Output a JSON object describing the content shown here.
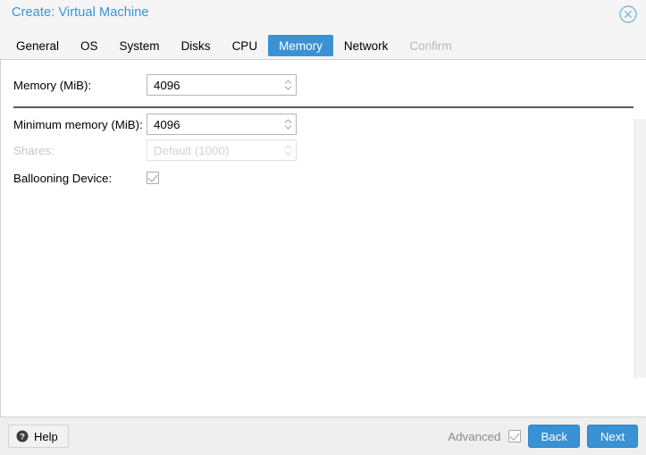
{
  "window": {
    "title": "Create: Virtual Machine",
    "close_icon": "close-circle-icon"
  },
  "tabs": [
    {
      "label": "General",
      "state": "normal"
    },
    {
      "label": "OS",
      "state": "normal"
    },
    {
      "label": "System",
      "state": "normal"
    },
    {
      "label": "Disks",
      "state": "normal"
    },
    {
      "label": "CPU",
      "state": "normal"
    },
    {
      "label": "Memory",
      "state": "active"
    },
    {
      "label": "Network",
      "state": "normal"
    },
    {
      "label": "Confirm",
      "state": "disabled"
    }
  ],
  "form": {
    "memory": {
      "label": "Memory (MiB):",
      "value": "4096",
      "spinner_icon": "spinner-updown-icon"
    },
    "minimum_memory": {
      "label": "Minimum memory (MiB):",
      "value": "4096",
      "spinner_icon": "spinner-updown-icon"
    },
    "shares": {
      "label": "Shares:",
      "placeholder": "Default (1000)",
      "spinner_icon": "spinner-updown-icon"
    },
    "ballooning": {
      "label": "Ballooning Device:",
      "checked": true
    }
  },
  "footer": {
    "help_label": "Help",
    "help_icon": "question-circle-icon",
    "advanced_label": "Advanced",
    "advanced_checked": true,
    "back_label": "Back",
    "next_label": "Next"
  },
  "colors": {
    "accent": "#3892d4",
    "title": "#3892d4",
    "header_bg": "#f5f5f5",
    "footer_bg": "#efefef",
    "panel_bg": "#ffffff",
    "disabled_text": "#b8b8b8",
    "divider": "#5c5c5c"
  }
}
